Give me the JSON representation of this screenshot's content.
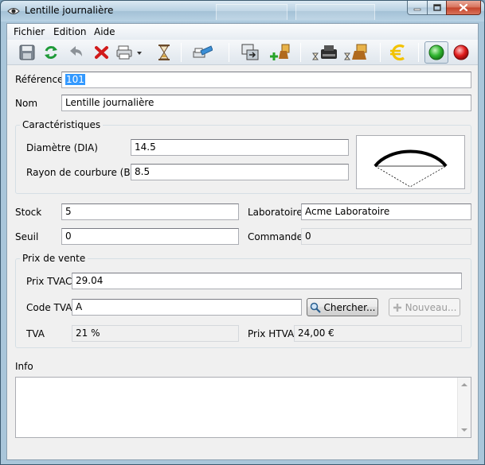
{
  "window": {
    "title": "Lentille journalière"
  },
  "menu": [
    "Fichier",
    "Edition",
    "Aide"
  ],
  "toolbar": {
    "icons": [
      "save-icon",
      "refresh-icon",
      "undo-icon",
      "delete-icon",
      "print-icon",
      "hourglass-icon",
      "label-print-icon",
      "copy-window-icon",
      "add-stock-icon",
      "register-icon",
      "stock-timer-icon",
      "euro-icon",
      "green-light-icon",
      "red-light-icon"
    ],
    "colors": {
      "green": "#2fb52f",
      "red": "#e11a1a",
      "euro": "#f2c200"
    }
  },
  "form": {
    "reference_label": "Référence",
    "reference_value": "101",
    "nom_label": "Nom",
    "nom_value": "Lentille journalière",
    "caracteristiques": {
      "title": "Caractéristiques",
      "diametre_label": "Diamètre (DIA)",
      "diametre_value": "14.5",
      "rayon_label": "Rayon de courbure (BC)",
      "rayon_value": "8.5"
    },
    "stock_label": "Stock",
    "stock_value": "5",
    "laboratoire_label": "Laboratoire",
    "laboratoire_value": "Acme Laboratoire",
    "seuil_label": "Seuil",
    "seuil_value": "0",
    "commande_label": "Commande",
    "commande_value": "0",
    "prix": {
      "title": "Prix de vente",
      "tvac_label": "Prix TVAC",
      "tvac_value": "29.04",
      "code_tva_label": "Code TVA",
      "code_tva_value": "A",
      "chercher_label": "Chercher...",
      "nouveau_label": "Nouveau...",
      "tva_label": "TVA",
      "tva_value": "21 %",
      "htva_label": "Prix HTVA",
      "htva_value": "24,00 €"
    },
    "info_label": "Info"
  }
}
